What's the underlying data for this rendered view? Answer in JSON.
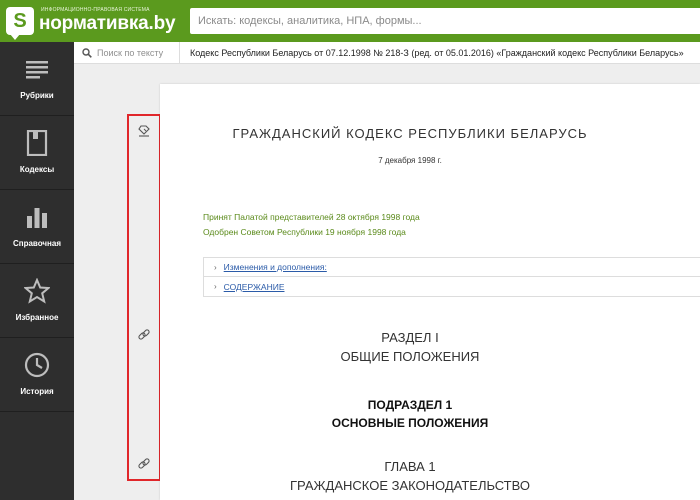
{
  "header": {
    "logo_letter": "S",
    "logo_tagline": "ИНФОРМАЦИОННО-ПРАВОВАЯ СИСТЕМА",
    "logo_name": "нормативка.by",
    "search_placeholder": "Искать: кодексы, аналитика, НПА, формы..."
  },
  "sidebar": {
    "items": [
      {
        "label": "Рубрики",
        "icon": "menu-lines-icon"
      },
      {
        "label": "Кодексы",
        "icon": "book-icon"
      },
      {
        "label": "Справочная",
        "icon": "bar-chart-icon"
      },
      {
        "label": "Избранное",
        "icon": "star-icon"
      },
      {
        "label": "История",
        "icon": "clock-icon"
      }
    ]
  },
  "subbar": {
    "text_search_placeholder": "Поиск по тексту",
    "doc_title": "Кодекс Республики Беларусь от 07.12.1998 № 218-З (ред. от 05.01.2016) «Гражданский кодекс Республики Беларусь»"
  },
  "gutter_icons": [
    "bookmark-icon",
    "link-icon",
    "link-icon"
  ],
  "document": {
    "title": "ГРАЖДАНСКИЙ КОДЕКС РЕСПУБЛИКИ БЕЛАРУСЬ",
    "date": "7 декабря 1998 г.",
    "adopted": "Принят Палатой представителей 28 октября 1998 года",
    "approved": "Одобрен Советом Республики 19 ноября 1998 года",
    "accordion": [
      "Изменения и дополнения:",
      "СОДЕРЖАНИЕ"
    ],
    "section_number": "РАЗДЕЛ I",
    "section_title": "ОБЩИЕ ПОЛОЖЕНИЯ",
    "subsection_number": "ПОДРАЗДЕЛ 1",
    "subsection_title": "ОСНОВНЫЕ ПОЛОЖЕНИЯ",
    "chapter_number": "ГЛАВА 1",
    "chapter_title": "ГРАЖДАНСКОЕ ЗАКОНОДАТЕЛЬСТВО"
  },
  "colors": {
    "brand_green": "#5b9a1e",
    "sidebar_bg": "#2e2e2e",
    "highlight_red": "#e0262a",
    "link_blue": "#2b5ba8"
  }
}
